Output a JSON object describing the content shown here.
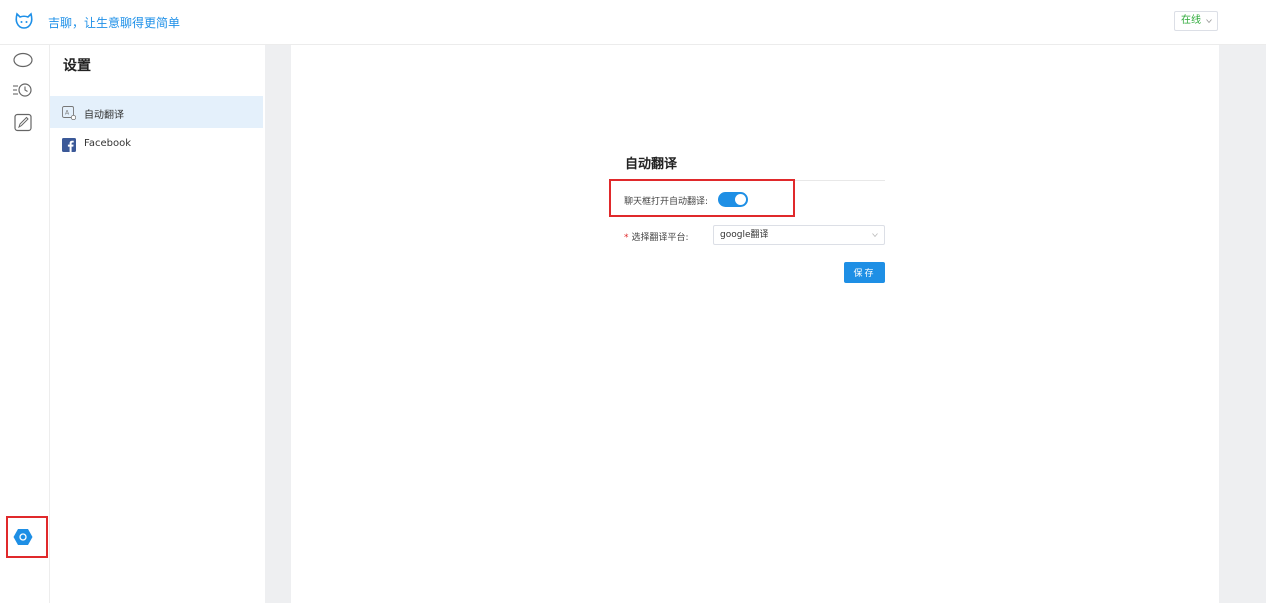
{
  "header": {
    "slogan": "吉聊，让生意聊得更简单",
    "status_label": "在线",
    "logo_icon": "cat-face-icon",
    "brand_color": "#1e90e8",
    "status_color": "#2eaa3a"
  },
  "iconbar": {
    "items": [
      {
        "icon": "chat-bubble-icon"
      },
      {
        "icon": "history-clock-icon"
      },
      {
        "icon": "edit-pencil-icon"
      }
    ],
    "settings_icon": "settings-gear-icon"
  },
  "settings": {
    "title": "设置",
    "menu": [
      {
        "label": "自动翻译",
        "icon": "translate-icon",
        "active": true
      },
      {
        "label": "Facebook",
        "icon": "facebook-icon",
        "active": false
      }
    ]
  },
  "form": {
    "title": "自动翻译",
    "toggle_label": "聊天框打开自动翻译:",
    "toggle_on": true,
    "platform_label": "选择翻译平台:",
    "platform_value": "google翻译",
    "save_label": "保存"
  },
  "colors": {
    "accent": "#1e8fe5",
    "highlight": "#e0292b"
  }
}
